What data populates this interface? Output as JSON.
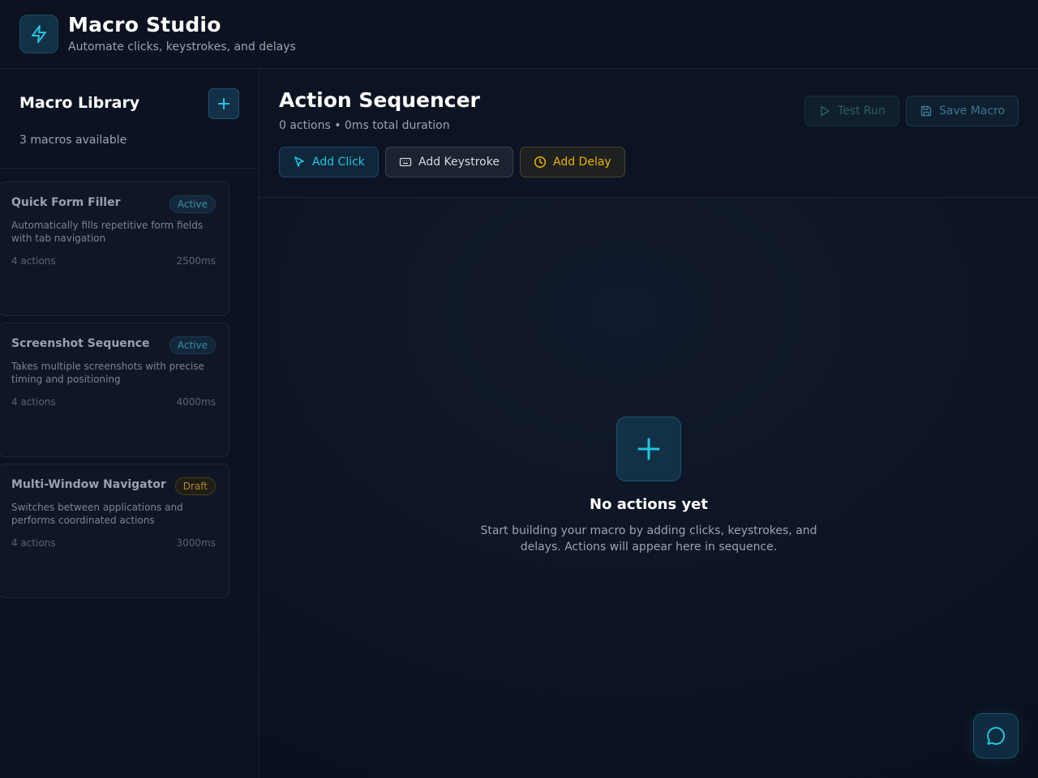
{
  "app": {
    "title": "Macro Studio",
    "subtitle": "Automate clicks, keystrokes, and delays",
    "logo_icon": "lightning-bolt-icon"
  },
  "sidebar": {
    "title": "Macro Library",
    "count_text": "3 macros available",
    "add_icon": "plus-icon",
    "macros": [
      {
        "name": "Quick Form Filler",
        "status": "Active",
        "description": "Automatically fills repetitive form fields with tab navigation",
        "actions": "4 actions",
        "duration": "2500ms"
      },
      {
        "name": "Screenshot Sequence",
        "status": "Active",
        "description": "Takes multiple screenshots with precise timing and positioning",
        "actions": "4 actions",
        "duration": "4000ms"
      },
      {
        "name": "Multi-Window Navigator",
        "status": "Draft",
        "description": "Switches between applications and performs coordinated actions",
        "actions": "4 actions",
        "duration": "3000ms"
      }
    ]
  },
  "main": {
    "title": "Action Sequencer",
    "summary": "0 actions • 0ms total duration",
    "toolbar": {
      "add_click": "Add Click",
      "add_keystroke": "Add Keystroke",
      "add_delay": "Add Delay",
      "test_run": "Test Run",
      "save_macro": "Save Macro"
    },
    "empty_state": {
      "title": "No actions yet",
      "text": "Start building your macro by adding clicks, keystrokes, and delays. Actions will appear here in sequence."
    }
  },
  "colors": {
    "accent": "#22c5e0",
    "delay": "#eab308",
    "background": "#0b1120"
  },
  "chat_icon": "chat-bubble-icon"
}
